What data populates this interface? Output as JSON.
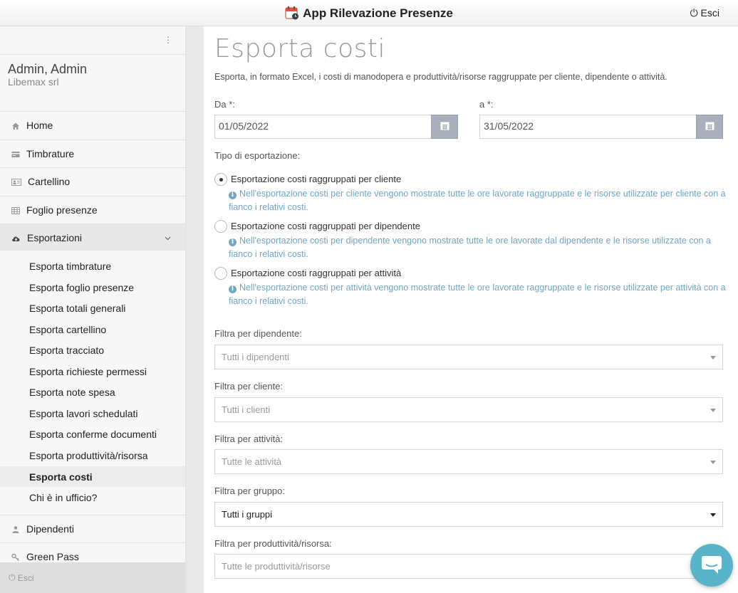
{
  "header": {
    "app_title": "App Rilevazione Presenze",
    "logout_label": "Esci"
  },
  "sidebar": {
    "menu_dots": "⋮",
    "user_name": "Admin, Admin",
    "company": "Libemax srl",
    "items": [
      {
        "label": "Home",
        "icon": "home-icon"
      },
      {
        "label": "Timbrature",
        "icon": "card-icon"
      },
      {
        "label": "Cartellino",
        "icon": "id-card-icon"
      },
      {
        "label": "Foglio presenze",
        "icon": "table-icon"
      },
      {
        "label": "Esportazioni",
        "icon": "cloud-download-icon"
      }
    ],
    "sub_items": [
      {
        "label": "Esporta timbrature"
      },
      {
        "label": "Esporta foglio presenze"
      },
      {
        "label": "Esporta totali generali"
      },
      {
        "label": "Esporta cartellino"
      },
      {
        "label": "Esporta tracciato"
      },
      {
        "label": "Esporta richieste permessi"
      },
      {
        "label": "Esporta note spesa"
      },
      {
        "label": "Esporta lavori schedulati"
      },
      {
        "label": "Esporta conferme documenti"
      },
      {
        "label": "Esporta produttività/risorsa"
      },
      {
        "label": "Esporta costi"
      },
      {
        "label": "Chi è in ufficio?"
      }
    ],
    "bottom_items": [
      {
        "label": "Dipendenti",
        "icon": "user-icon"
      },
      {
        "label": "Green Pass",
        "icon": "key-icon"
      }
    ],
    "footer_label": "Esci"
  },
  "main": {
    "title": "Esporta costi",
    "subtitle": "Esporta, in formato Excel, i costi di manodopera e produttività/risorse raggruppate per cliente, dipendente o attività.",
    "from_label": "Da *:",
    "from_value": "01/05/2022",
    "to_label": "a *:",
    "to_value": "31/05/2022",
    "export_type_label": "Tipo di esportazione:",
    "options": [
      {
        "label": "Esportazione costi raggruppati per cliente",
        "info": "Nell'esportazione costi per cliente vengono mostrate tutte le ore lavorate raggruppate e le risorse utilizzate per cliente con a fianco i relativi costi.",
        "checked": true
      },
      {
        "label": "Esportazione costi raggruppati per dipendente",
        "info": "Nell'esportazione costi per dipendente vengono mostrate tutte le ore lavorate dal dipendente e le risorse utilizzate con a fianco i relativi costi.",
        "checked": false
      },
      {
        "label": "Esportazione costi raggruppati per attività",
        "info": "Nell'esportazione costi per attività vengono mostrate tutte le ore lavorate raggruppate e le risorse utilizzate per attività con a fianco i relativi costi.",
        "checked": false
      }
    ],
    "filters": [
      {
        "label": "Filtra per dipendente:",
        "value": "Tutti i dipendenti"
      },
      {
        "label": "Filtra per cliente:",
        "value": "Tutti i clienti"
      },
      {
        "label": "Filtra per attività:",
        "value": "Tutte le attività"
      },
      {
        "label": "Filtra per gruppo:",
        "value": "Tutti i gruppi"
      },
      {
        "label": "Filtra per produttività/risorsa:",
        "value": "Tutte le produttività/risorse"
      }
    ]
  },
  "colors": {
    "info_text": "#6fa7c5",
    "calendar_button": "#a9afbb",
    "chat_button": "#58b4c9"
  }
}
